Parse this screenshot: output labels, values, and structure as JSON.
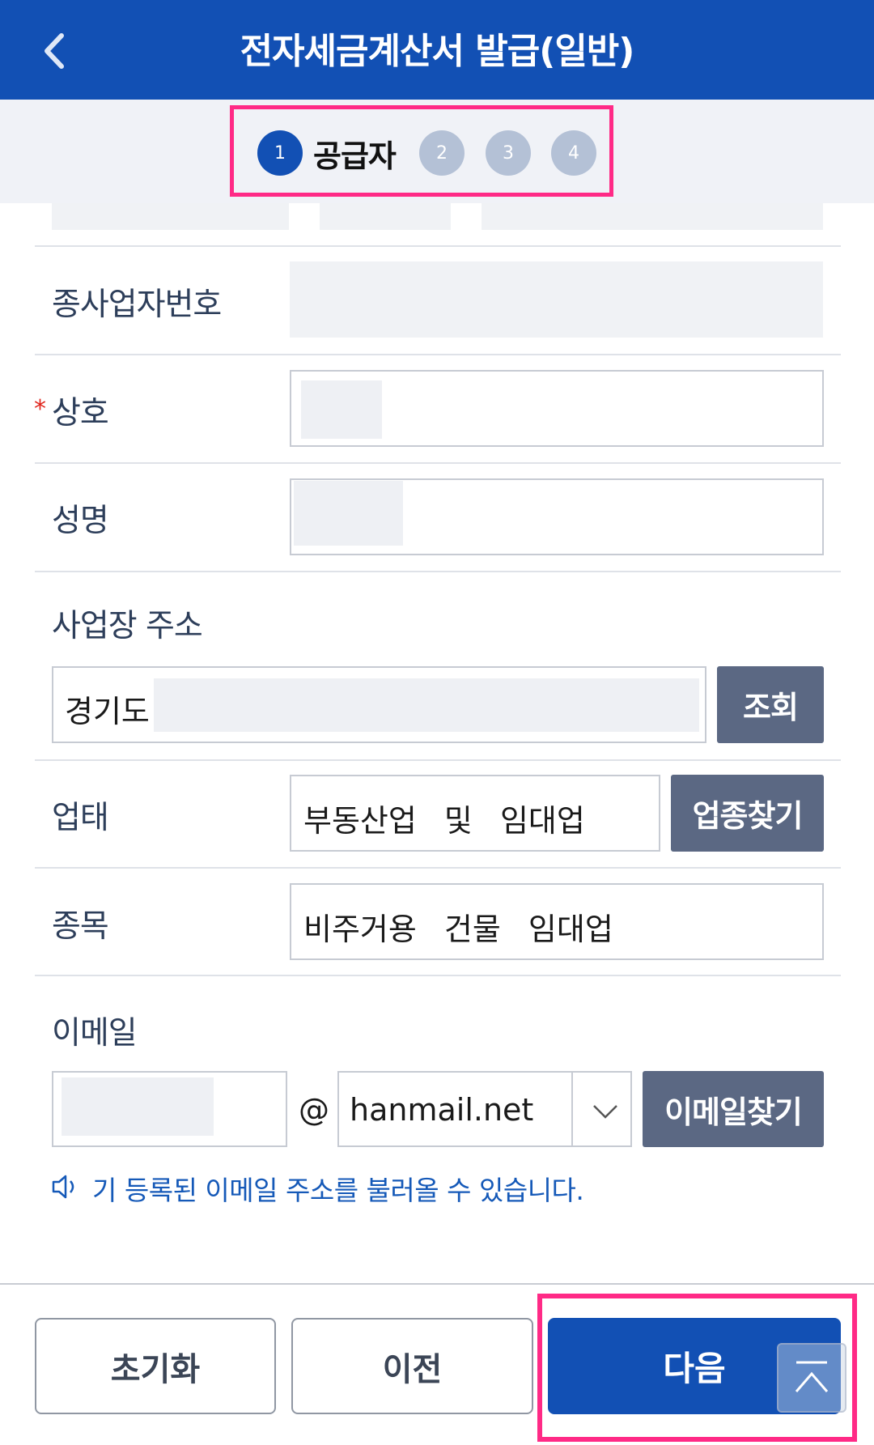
{
  "header": {
    "title": "전자세금계산서 발급(일반)"
  },
  "steps": {
    "items": [
      {
        "number": "1",
        "label": "공급자"
      },
      {
        "number": "2"
      },
      {
        "number": "3"
      },
      {
        "number": "4"
      }
    ]
  },
  "form": {
    "sub_business_no_label": "종사업자번호",
    "company_label": "상호",
    "required_mark": "*",
    "name_label": "성명",
    "address_label": "사업장 주소",
    "address_value": "경기도",
    "address_search_button": "조회",
    "business_type_label": "업태",
    "business_type_value": "부동산업 및 임대업",
    "business_type_button": "업종찾기",
    "item_label": "종목",
    "item_value": "비주거용 건물 임대업",
    "email_label": "이메일",
    "email_at": "@",
    "email_domain": "hanmail.net",
    "email_find_button": "이메일찾기",
    "email_hint": "기 등록된 이메일 주소를 불러올 수 있습니다."
  },
  "footer": {
    "reset_button": "초기화",
    "prev_button": "이전",
    "next_button": "다음"
  },
  "colors": {
    "primary": "#1250b4",
    "highlight": "#ff2a86",
    "gray_button": "#5b6883",
    "required": "#e0261d"
  },
  "icons": [
    "chevron-left-icon",
    "chevron-down-icon",
    "speaker-icon",
    "scroll-top-icon"
  ]
}
